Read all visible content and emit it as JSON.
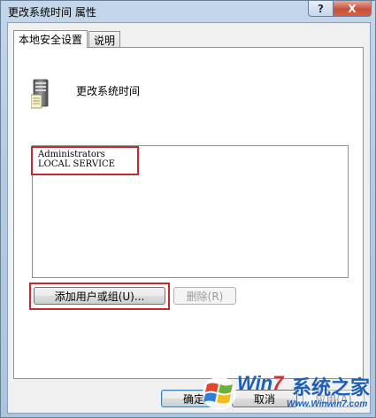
{
  "window": {
    "title": "更改系统时间 属性",
    "help_glyph": "?",
    "close_glyph": "X"
  },
  "tabs": [
    {
      "label": "本地安全设置",
      "active": true
    },
    {
      "label": "说明",
      "active": false
    }
  ],
  "policy": {
    "title": "更改系统时间",
    "icon": "server-policy-icon"
  },
  "members": [
    "Administrators",
    "LOCAL SERVICE"
  ],
  "buttons": {
    "add": "添加用户或组(U)...",
    "remove": "删除(R)",
    "ok": "确定",
    "cancel": "取消",
    "apply": "应用(A)"
  },
  "watermark": {
    "brand_prefix": "Win",
    "brand_seven": "7",
    "brand_cn": "系统之家",
    "url": "Www.Winwin7.com"
  },
  "colors": {
    "highlight": "#c8282c",
    "watermark_blue": "#1d5fb8"
  }
}
